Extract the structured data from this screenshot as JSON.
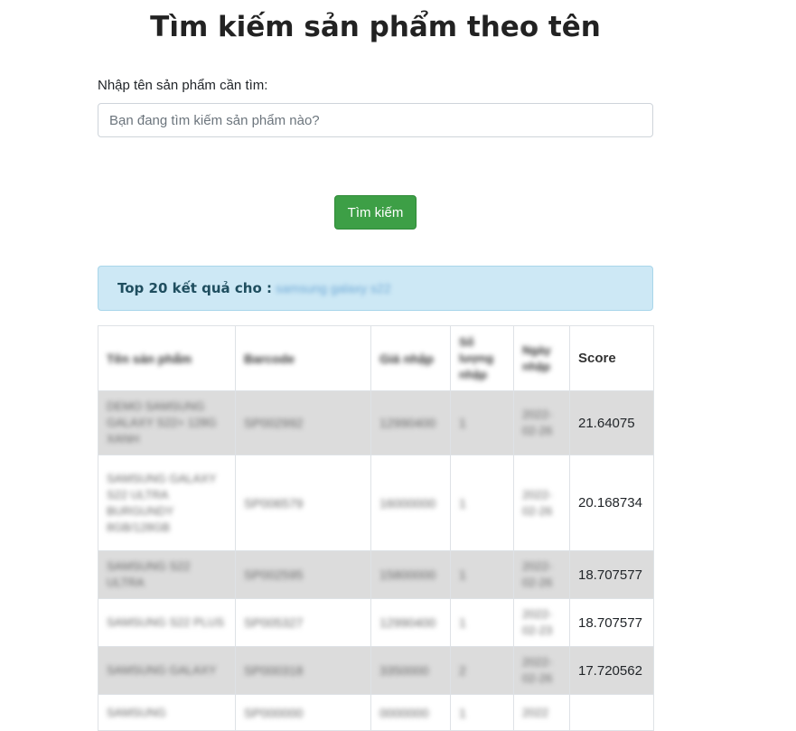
{
  "page": {
    "title": "Tìm kiếm sản phẩm theo tên"
  },
  "search": {
    "label": "Nhập tên sản phẩm cần tìm:",
    "placeholder": "Bạn đang tìm kiếm sản phẩm nào?",
    "button_label": "Tìm kiếm"
  },
  "result_alert": {
    "prefix": "Top 20 kết quả cho :",
    "query": "samsung galaxy s22"
  },
  "table": {
    "headers": [
      "Tên sản phẩm",
      "Barcode",
      "Giá nhập",
      "Số lượng nhập",
      "Ngày nhập",
      "Score"
    ],
    "rows": [
      {
        "name": "DEMO SAMSUNG GALAXY S22+ 128G XANH",
        "barcode": "SP002992",
        "price": "12990400",
        "qty": "1",
        "date": "2022-02-26",
        "score": "21.64075"
      },
      {
        "name": "SAMSUNG GALAXY S22 ULTRA BURGUNDY 8GB/128GB",
        "barcode": "SP006579",
        "price": "16000000",
        "qty": "1",
        "date": "2022-02-26",
        "score": "20.168734"
      },
      {
        "name": "SAMSUNG S22 ULTRA",
        "barcode": "SP002595",
        "price": "15800000",
        "qty": "1",
        "date": "2022-02-26",
        "score": "18.707577"
      },
      {
        "name": "SAMSUNG S22 PLUS",
        "barcode": "SP005327",
        "price": "12990400",
        "qty": "1",
        "date": "2022-02-23",
        "score": "18.707577"
      },
      {
        "name": "SAMSUNG GALAXY",
        "barcode": "SP000318",
        "price": "3350000",
        "qty": "2",
        "date": "2022-02-26",
        "score": "17.720562"
      },
      {
        "name": "SAMSUNG",
        "barcode": "SP000000",
        "price": "0000000",
        "qty": "1",
        "date": "2022",
        "score": ""
      }
    ]
  }
}
